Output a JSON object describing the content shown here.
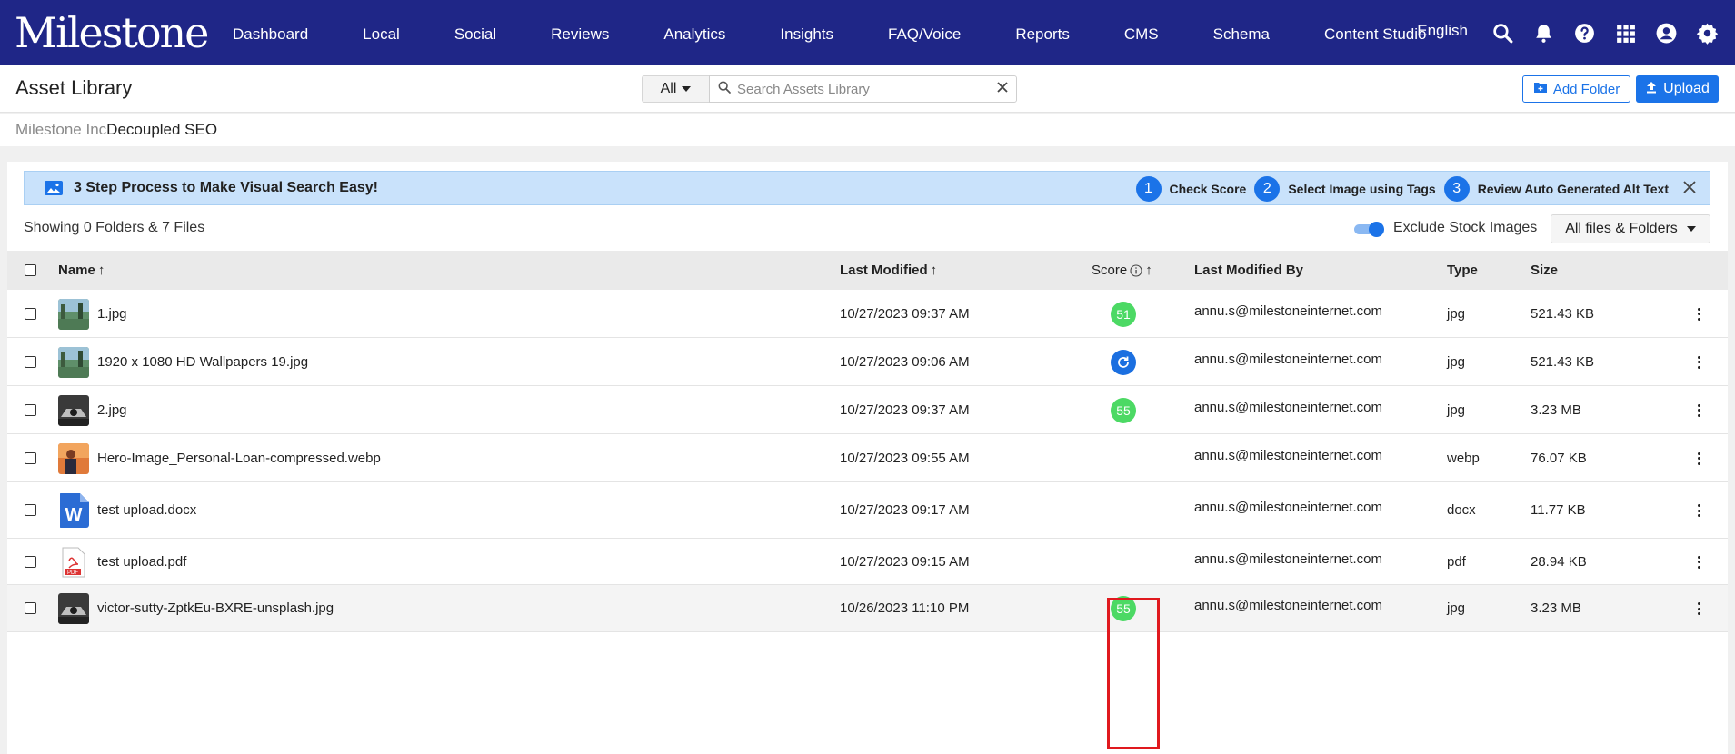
{
  "nav": {
    "logo": "Milestone",
    "items": [
      "Dashboard",
      "Local",
      "Social",
      "Reviews",
      "Analytics",
      "Insights",
      "FAQ/Voice",
      "Reports",
      "CMS",
      "Schema",
      "Content Studio"
    ],
    "language": "English",
    "icons": [
      "search-icon",
      "bell-icon",
      "help-icon",
      "apps-grid-icon",
      "account-icon",
      "gear-icon"
    ]
  },
  "header": {
    "title": "Asset Library",
    "filter": "All",
    "search_placeholder": "Search Assets Library",
    "add_folder": "Add Folder",
    "upload": "Upload"
  },
  "breadcrumb": {
    "parent": "Milestone Inc",
    "current": "Decoupled SEO"
  },
  "banner": {
    "title": "3 Step Process to Make Visual Search Easy!",
    "steps": [
      {
        "num": "1",
        "label": "Check Score"
      },
      {
        "num": "2",
        "label": "Select Image using Tags"
      },
      {
        "num": "3",
        "label": "Review Auto Generated Alt Text"
      }
    ]
  },
  "toolbar": {
    "showing": "Showing 0 Folders & 7 Files",
    "exclude_stock": "Exclude Stock Images",
    "exclude_stock_on": true,
    "files_filter": "All files & Folders"
  },
  "table": {
    "columns": {
      "name": "Name",
      "modified": "Last Modified",
      "score": "Score",
      "modified_by": "Last Modified By",
      "type": "Type",
      "size": "Size"
    },
    "rows": [
      {
        "name": "1.jpg",
        "modified": "10/27/2023 09:37 AM",
        "score": "51",
        "by": "annu.s@milestoneinternet.com",
        "type": "jpg",
        "size": "521.43 KB",
        "thumb": "landscape"
      },
      {
        "name": "1920 x 1080 HD Wallpapers 19.jpg",
        "modified": "10/27/2023 09:06 AM",
        "score": "refresh",
        "by": "annu.s@milestoneinternet.com",
        "type": "jpg",
        "size": "521.43 KB",
        "thumb": "landscape"
      },
      {
        "name": "2.jpg",
        "modified": "10/27/2023 09:37 AM",
        "score": "55",
        "by": "annu.s@milestoneinternet.com",
        "type": "jpg",
        "size": "3.23 MB",
        "thumb": "car"
      },
      {
        "name": "Hero-Image_Personal-Loan-compressed.webp",
        "modified": "10/27/2023 09:55 AM",
        "score": "",
        "by": "annu.s@milestoneinternet.com",
        "type": "webp",
        "size": "76.07 KB",
        "thumb": "hero"
      },
      {
        "name": "test upload.docx",
        "modified": "10/27/2023 09:17 AM",
        "score": "",
        "by": "annu.s@milestoneinternet.com",
        "type": "docx",
        "size": "11.77 KB",
        "thumb": "word"
      },
      {
        "name": "test upload.pdf",
        "modified": "10/27/2023 09:15 AM",
        "score": "",
        "by": "annu.s@milestoneinternet.com",
        "type": "pdf",
        "size": "28.94 KB",
        "thumb": "pdf"
      },
      {
        "name": "victor-sutty-ZptkEu-BXRE-unsplash.jpg",
        "modified": "10/26/2023 11:10 PM",
        "score": "55",
        "by": "annu.s@milestoneinternet.com",
        "type": "jpg",
        "size": "3.23 MB",
        "thumb": "car"
      }
    ]
  },
  "colors": {
    "nav_bg": "#1f2687",
    "accent": "#1b73e8",
    "score_green": "#4cd964",
    "highlight": "#e0191e"
  }
}
